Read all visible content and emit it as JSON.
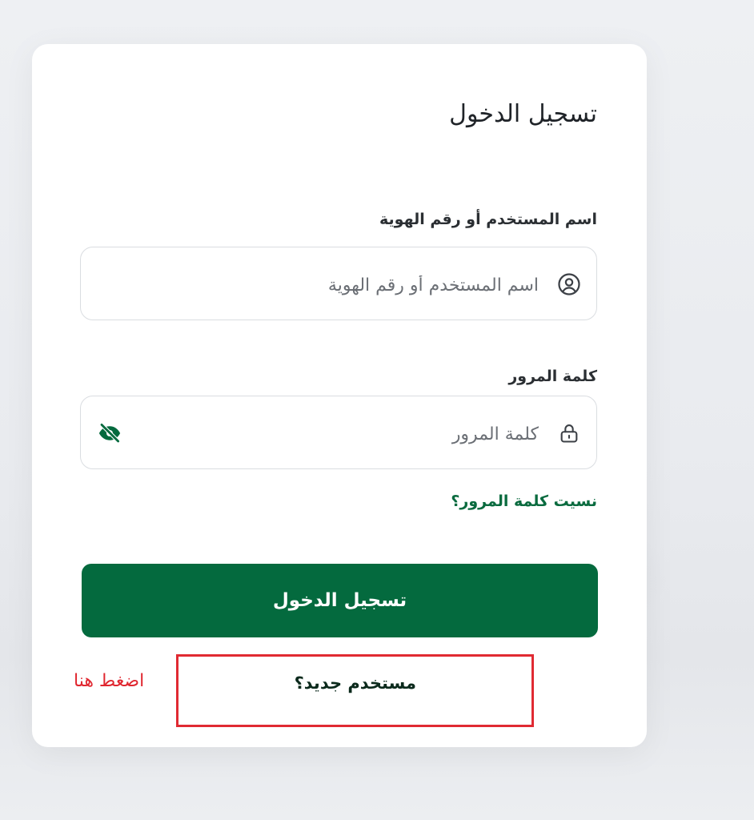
{
  "login": {
    "title": "تسجيل الدخول",
    "username_label": "اسم المستخدم أو رقم الهوية",
    "username_placeholder": "اسم المستخدم أو رقم الهوية",
    "username_value": "",
    "username_icon": "user-circle-icon",
    "password_label": "كلمة المرور",
    "password_placeholder": "كلمة المرور",
    "password_value": "",
    "password_icon": "lock-icon",
    "visibility_icon": "eye-slash-icon",
    "forgot_password": "نسيت كلمة المرور؟",
    "submit_label": "تسجيل الدخول",
    "new_user_label": "مستخدم جديد؟"
  },
  "annotation": {
    "hint_text": "اضغط هنا",
    "color": "#e02a32"
  },
  "colors": {
    "primary": "#046a3e",
    "link": "#0a6b3f"
  }
}
